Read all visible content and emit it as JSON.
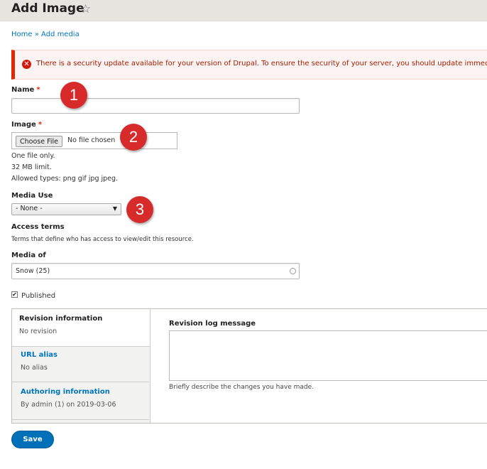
{
  "header": {
    "title": "Add Image",
    "star_icon": "star-outline-icon"
  },
  "breadcrumb": {
    "home": "Home",
    "separator": "»",
    "current": "Add media"
  },
  "alert": {
    "icon": "error-circle-icon",
    "text": "There is a security update available for your version of Drupal. To ensure the security of your server, you should update immediately!"
  },
  "form": {
    "name": {
      "label": "Name",
      "required": "*",
      "value": ""
    },
    "image": {
      "label": "Image",
      "required": "*",
      "button": "Choose File",
      "status": "No file chosen",
      "help": [
        "One file only.",
        "32 MB limit.",
        "Allowed types: png gif jpg jpeg."
      ]
    },
    "media_use": {
      "label": "Media Use",
      "selected": "- None -"
    },
    "access_terms": {
      "label": "Access terms",
      "help": "Terms that define who has access to view/edit this resource."
    },
    "media_of": {
      "label": "Media of",
      "value": "Snow (25)"
    },
    "published": {
      "label": "Published",
      "checked": true
    }
  },
  "vertical_tabs": [
    {
      "title": "Revision information",
      "summary": "No revision"
    },
    {
      "title": "URL alias",
      "summary": "No alias"
    },
    {
      "title": "Authoring information",
      "summary": "By admin (1) on 2019-03-06"
    }
  ],
  "revision": {
    "label": "Revision log message",
    "help": "Briefly describe the changes you have made."
  },
  "actions": {
    "save": "Save"
  },
  "annotations": [
    "1",
    "2",
    "3"
  ],
  "colors": {
    "accent": "#0074bd",
    "error": "#e62600",
    "badge": "#d72b2b",
    "save": "#0071b8"
  }
}
